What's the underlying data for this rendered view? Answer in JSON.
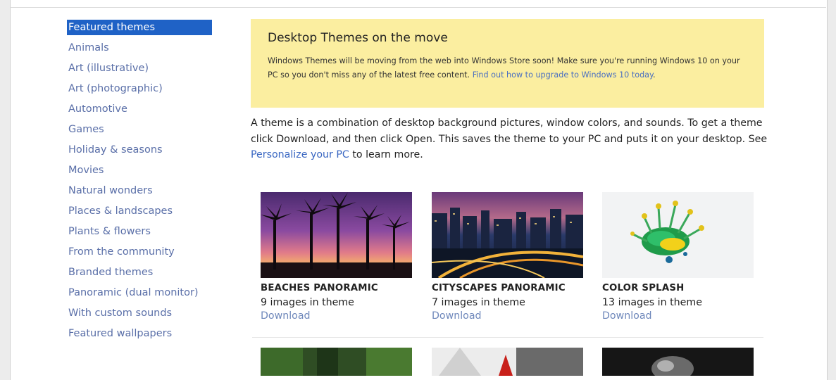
{
  "sidebar": {
    "items": [
      {
        "label": "Featured themes",
        "active": true
      },
      {
        "label": "Animals"
      },
      {
        "label": "Art (illustrative)"
      },
      {
        "label": "Art (photographic)"
      },
      {
        "label": "Automotive"
      },
      {
        "label": "Games"
      },
      {
        "label": "Holiday & seasons"
      },
      {
        "label": "Movies"
      },
      {
        "label": "Natural wonders"
      },
      {
        "label": "Places & landscapes"
      },
      {
        "label": "Plants & flowers"
      },
      {
        "label": "From the community"
      },
      {
        "label": "Branded themes"
      },
      {
        "label": "Panoramic (dual monitor)"
      },
      {
        "label": "With custom sounds"
      },
      {
        "label": "Featured wallpapers"
      }
    ]
  },
  "notice": {
    "title": "Desktop Themes on the move",
    "body": "Windows Themes will be moving from the web into Windows Store soon! Make sure you're running Windows 10 on your PC so you don't miss any of the latest free content.",
    "link": "Find out how to upgrade to Windows 10 today",
    "suffix": "."
  },
  "intro": {
    "text": "A theme is a combination of desktop background pictures, window colors, and sounds. To get a theme click Download, and then click Open. This saves the theme to your PC and puts it on your desktop. See",
    "link": "Personalize your PC",
    "suffix": "to learn more."
  },
  "themes": [
    {
      "title": "BEACHES PANORAMIC",
      "count": "9 images in theme",
      "download": "Download",
      "icon": "beach-sunset-thumbnail"
    },
    {
      "title": "CITYSCAPES PANORAMIC",
      "count": "7 images in theme",
      "download": "Download",
      "icon": "cityscape-night-thumbnail"
    },
    {
      "title": "COLOR SPLASH",
      "count": "13 images in theme",
      "download": "Download",
      "icon": "color-splash-thumbnail"
    }
  ],
  "colors": {
    "accent": "#1f62c6",
    "link": "#5a6fa8",
    "notice_bg": "#fbeea0"
  }
}
